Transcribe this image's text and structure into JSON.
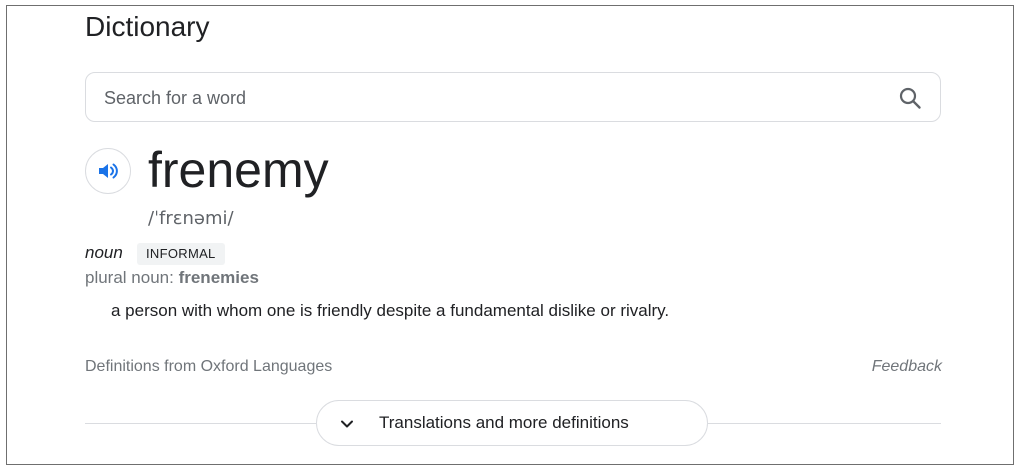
{
  "dictionary": {
    "title": "Dictionary",
    "search": {
      "placeholder": "Search for a word",
      "value": ""
    },
    "entry": {
      "word": "frenemy",
      "phonetic": "/ˈfrɛnəmi/",
      "part_of_speech": "noun",
      "register_badge": "INFORMAL",
      "plural_label": "plural noun:",
      "plural_value": "frenemies",
      "definition": "a person with whom one is friendly despite a fundamental dislike or rivalry."
    },
    "footer": {
      "source": "Definitions from Oxford Languages",
      "feedback": "Feedback"
    },
    "more_button": {
      "label": "Translations and more definitions"
    }
  },
  "icons": {
    "search": "search-icon",
    "speaker": "speaker-icon",
    "chevron": "chevron-down-icon"
  },
  "colors": {
    "accent_blue": "#1a73e8",
    "text_primary": "#202124",
    "text_secondary": "#70757a",
    "border": "#dadce0"
  }
}
